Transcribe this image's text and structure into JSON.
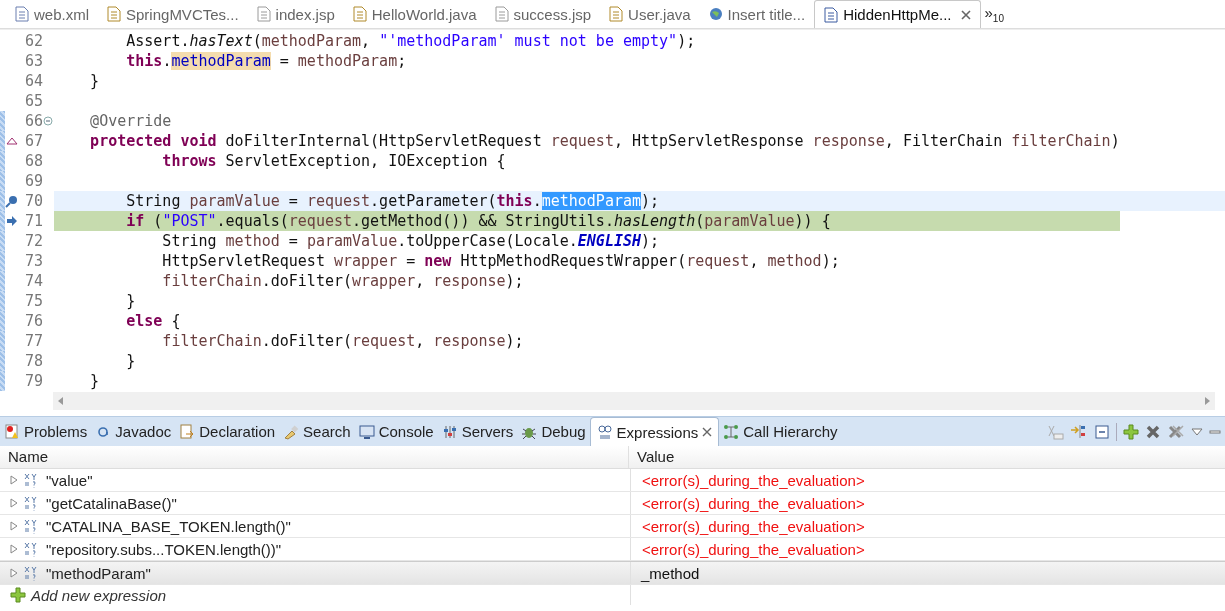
{
  "editor_tabs": [
    {
      "label": "web.xml",
      "selected": false,
      "closable": false
    },
    {
      "label": "SpringMVCTes...",
      "selected": false,
      "closable": false
    },
    {
      "label": "index.jsp",
      "selected": false,
      "closable": false
    },
    {
      "label": "HelloWorld.java",
      "selected": false,
      "closable": false
    },
    {
      "label": "success.jsp",
      "selected": false,
      "closable": false
    },
    {
      "label": "User.java",
      "selected": false,
      "closable": false
    },
    {
      "label": "Insert title...",
      "selected": false,
      "closable": false
    },
    {
      "label": "HiddenHttpMe...",
      "selected": true,
      "closable": true
    }
  ],
  "overflow": {
    "label": "»",
    "count": "10"
  },
  "code_lines": [
    {
      "number": "62",
      "kind": "plain",
      "current": false,
      "debug": false,
      "range": false,
      "fold": false,
      "tokens": [
        {
          "text": "        Assert.",
          "kind": "plain"
        },
        {
          "text": "hasText",
          "kind": "static"
        },
        {
          "text": "(",
          "kind": "plain"
        },
        {
          "text": "methodParam",
          "kind": "local"
        },
        {
          "text": ", ",
          "kind": "plain"
        },
        {
          "text": "\"'methodParam' must not be empty\"",
          "kind": "string"
        },
        {
          "text": ");",
          "kind": "plain"
        }
      ]
    },
    {
      "number": "63",
      "kind": "plain",
      "current": false,
      "debug": false,
      "range": false,
      "fold": false,
      "tokens": [
        {
          "text": "        this",
          "kind": "keyword"
        },
        {
          "text": ".",
          "kind": "plain"
        },
        {
          "text": "methodParam",
          "kind": "field",
          "occurrence": true
        },
        {
          "text": " = ",
          "kind": "plain"
        },
        {
          "text": "methodParam",
          "kind": "local"
        },
        {
          "text": ";",
          "kind": "plain"
        }
      ]
    },
    {
      "number": "64",
      "kind": "plain",
      "current": false,
      "debug": false,
      "range": false,
      "fold": false,
      "tokens": [
        {
          "text": "    }",
          "kind": "plain"
        }
      ]
    },
    {
      "number": "65",
      "kind": "plain",
      "current": false,
      "debug": false,
      "range": false,
      "fold": false
    },
    {
      "number": "66",
      "kind": "plain",
      "current": false,
      "debug": false,
      "range": true,
      "fold": true,
      "tokens": [
        {
          "text": "    @Override",
          "kind": "annotation"
        }
      ]
    },
    {
      "number": "67",
      "kind": "override",
      "current": false,
      "debug": false,
      "range": true,
      "fold": false,
      "tokens": [
        {
          "text": "    protected void",
          "kind": "keyword"
        },
        {
          "text": " doFilterInternal(HttpServletRequest ",
          "kind": "plain"
        },
        {
          "text": "request",
          "kind": "local"
        },
        {
          "text": ", HttpServletResponse ",
          "kind": "plain"
        },
        {
          "text": "response",
          "kind": "local"
        },
        {
          "text": ", FilterChain ",
          "kind": "plain"
        },
        {
          "text": "filterChain",
          "kind": "local"
        },
        {
          "text": ")",
          "kind": "plain"
        }
      ]
    },
    {
      "number": "68",
      "kind": "plain",
      "current": false,
      "debug": false,
      "range": true,
      "fold": false,
      "tokens": [
        {
          "text": "            throws",
          "kind": "keyword"
        },
        {
          "text": " ServletException, IOException {",
          "kind": "plain"
        }
      ]
    },
    {
      "number": "69",
      "kind": "plain",
      "current": false,
      "debug": false,
      "range": true,
      "fold": false
    },
    {
      "number": "70",
      "kind": "breakpoint",
      "current": true,
      "debug": false,
      "range": true,
      "fold": false,
      "tokens": [
        {
          "text": "        String ",
          "kind": "plain"
        },
        {
          "text": "paramValue",
          "kind": "local"
        },
        {
          "text": " = ",
          "kind": "plain"
        },
        {
          "text": "request",
          "kind": "local"
        },
        {
          "text": ".getParameter(",
          "kind": "plain"
        },
        {
          "text": "this",
          "kind": "keyword"
        },
        {
          "text": ".",
          "kind": "plain"
        },
        {
          "text": "methodParam",
          "kind": "field",
          "selected": true
        },
        {
          "text": ");",
          "kind": "plain"
        }
      ]
    },
    {
      "number": "71",
      "kind": "pointer",
      "current": false,
      "debug": true,
      "range": true,
      "fold": false,
      "tokens": [
        {
          "text": "        if",
          "kind": "keyword"
        },
        {
          "text": " (",
          "kind": "plain"
        },
        {
          "text": "\"POST\"",
          "kind": "string"
        },
        {
          "text": ".equals(",
          "kind": "plain"
        },
        {
          "text": "request",
          "kind": "local"
        },
        {
          "text": ".getMethod()) && StringUtils.",
          "kind": "plain"
        },
        {
          "text": "hasLength",
          "kind": "static"
        },
        {
          "text": "(",
          "kind": "plain"
        },
        {
          "text": "paramValue",
          "kind": "local"
        },
        {
          "text": ")) {",
          "kind": "plain"
        }
      ]
    },
    {
      "number": "72",
      "kind": "plain",
      "current": false,
      "debug": false,
      "range": true,
      "fold": false,
      "tokens": [
        {
          "text": "            String ",
          "kind": "plain"
        },
        {
          "text": "method",
          "kind": "local"
        },
        {
          "text": " = ",
          "kind": "plain"
        },
        {
          "text": "paramValue",
          "kind": "local"
        },
        {
          "text": ".toUpperCase(Locale.",
          "kind": "plain"
        },
        {
          "text": "ENGLISH",
          "kind": "constant"
        },
        {
          "text": ");",
          "kind": "plain"
        }
      ]
    },
    {
      "number": "73",
      "kind": "plain",
      "current": false,
      "debug": false,
      "range": true,
      "fold": false,
      "tokens": [
        {
          "text": "            HttpServletRequest ",
          "kind": "plain"
        },
        {
          "text": "wrapper",
          "kind": "local"
        },
        {
          "text": " = ",
          "kind": "plain"
        },
        {
          "text": "new",
          "kind": "keyword"
        },
        {
          "text": " HttpMethodRequestWrapper(",
          "kind": "plain"
        },
        {
          "text": "request",
          "kind": "local"
        },
        {
          "text": ", ",
          "kind": "plain"
        },
        {
          "text": "method",
          "kind": "local"
        },
        {
          "text": ");",
          "kind": "plain"
        }
      ]
    },
    {
      "number": "74",
      "kind": "plain",
      "current": false,
      "debug": false,
      "range": true,
      "fold": false,
      "tokens": [
        {
          "text": "            filterChain",
          "kind": "local"
        },
        {
          "text": ".doFilter(",
          "kind": "plain"
        },
        {
          "text": "wrapper",
          "kind": "local"
        },
        {
          "text": ", ",
          "kind": "plain"
        },
        {
          "text": "response",
          "kind": "local"
        },
        {
          "text": ");",
          "kind": "plain"
        }
      ]
    },
    {
      "number": "75",
      "kind": "plain",
      "current": false,
      "debug": false,
      "range": true,
      "fold": false,
      "tokens": [
        {
          "text": "        }",
          "kind": "plain"
        }
      ]
    },
    {
      "number": "76",
      "kind": "plain",
      "current": false,
      "debug": false,
      "range": true,
      "fold": false,
      "tokens": [
        {
          "text": "        else",
          "kind": "keyword"
        },
        {
          "text": " {",
          "kind": "plain"
        }
      ]
    },
    {
      "number": "77",
      "kind": "plain",
      "current": false,
      "debug": false,
      "range": true,
      "fold": false,
      "tokens": [
        {
          "text": "            filterChain",
          "kind": "local"
        },
        {
          "text": ".doFilter(",
          "kind": "plain"
        },
        {
          "text": "request",
          "kind": "local"
        },
        {
          "text": ", ",
          "kind": "plain"
        },
        {
          "text": "response",
          "kind": "local"
        },
        {
          "text": ");",
          "kind": "plain"
        }
      ]
    },
    {
      "number": "78",
      "kind": "plain",
      "current": false,
      "debug": false,
      "range": true,
      "fold": false,
      "tokens": [
        {
          "text": "        }",
          "kind": "plain"
        }
      ]
    },
    {
      "number": "79",
      "kind": "plain",
      "current": false,
      "debug": false,
      "range": true,
      "fold": false,
      "tokens": [
        {
          "text": "    }",
          "kind": "plain"
        }
      ]
    }
  ],
  "panel_tabs": [
    {
      "label": "Problems",
      "selected": false,
      "closable": false
    },
    {
      "label": "Javadoc",
      "selected": false,
      "closable": false
    },
    {
      "label": "Declaration",
      "selected": false,
      "closable": false
    },
    {
      "label": "Search",
      "selected": false,
      "closable": false
    },
    {
      "label": "Console",
      "selected": false,
      "closable": false
    },
    {
      "label": "Servers",
      "selected": false,
      "closable": false
    },
    {
      "label": "Debug",
      "selected": false,
      "closable": false
    },
    {
      "label": "Expressions",
      "selected": true,
      "closable": true
    },
    {
      "label": "Call Hierarchy",
      "selected": false,
      "closable": false
    }
  ],
  "table": {
    "columns": [
      "Name",
      "Value"
    ],
    "rows": [
      {
        "name": "\"value\"",
        "value": "<error(s)_during_the_evaluation>",
        "error": true,
        "selected": false
      },
      {
        "name": "\"getCatalinaBase()\"",
        "value": "<error(s)_during_the_evaluation>",
        "error": true,
        "selected": false
      },
      {
        "name": "\"CATALINA_BASE_TOKEN.length()\"",
        "value": "<error(s)_during_the_evaluation>",
        "error": true,
        "selected": false
      },
      {
        "name": "\"repository.subs...TOKEN.length())\"",
        "value": "<error(s)_during_the_evaluation>",
        "error": true,
        "selected": false
      },
      {
        "name": "\"methodParam\"",
        "value": "_method",
        "error": false,
        "selected": true
      }
    ],
    "add_expression": "Add new expression"
  }
}
